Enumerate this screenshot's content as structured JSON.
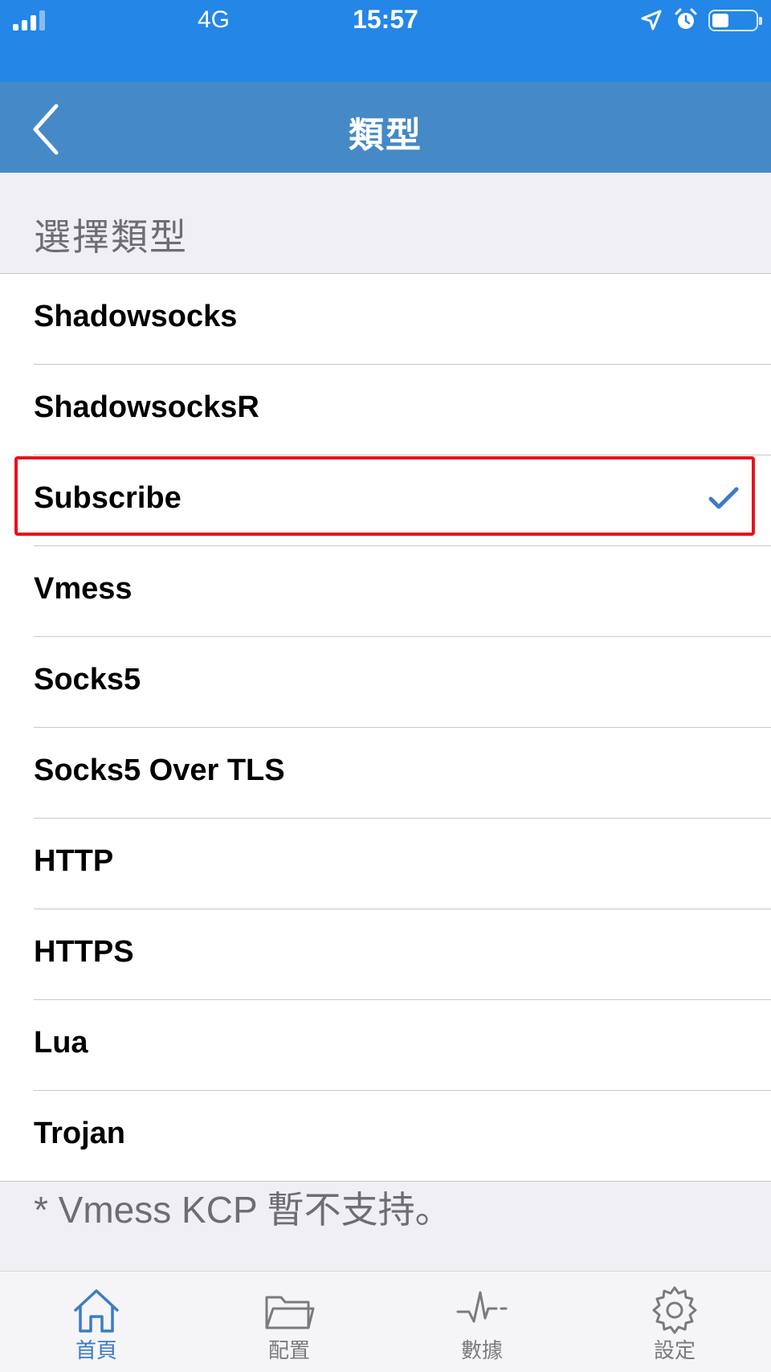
{
  "status_bar": {
    "network": "4G",
    "time": "15:57"
  },
  "nav": {
    "title": "類型"
  },
  "section_header": "選擇類型",
  "types": [
    {
      "label": "Shadowsocks",
      "selected": false
    },
    {
      "label": "ShadowsocksR",
      "selected": false
    },
    {
      "label": "Subscribe",
      "selected": true
    },
    {
      "label": "Vmess",
      "selected": false
    },
    {
      "label": "Socks5",
      "selected": false
    },
    {
      "label": "Socks5 Over TLS",
      "selected": false
    },
    {
      "label": "HTTP",
      "selected": false
    },
    {
      "label": "HTTPS",
      "selected": false
    },
    {
      "label": "Lua",
      "selected": false
    },
    {
      "label": "Trojan",
      "selected": false
    }
  ],
  "footnote": "* Vmess KCP 暫不支持。",
  "tabs": [
    {
      "label": "首頁",
      "icon": "home-icon",
      "active": true
    },
    {
      "label": "配置",
      "icon": "folder-icon",
      "active": false
    },
    {
      "label": "數據",
      "icon": "pulse-icon",
      "active": false
    },
    {
      "label": "設定",
      "icon": "gear-icon",
      "active": false
    }
  ],
  "colors": {
    "status_bar": "#2486e6",
    "nav_bar": "#4589c6",
    "accent": "#3b7cc4",
    "highlight": "#e8131b"
  }
}
